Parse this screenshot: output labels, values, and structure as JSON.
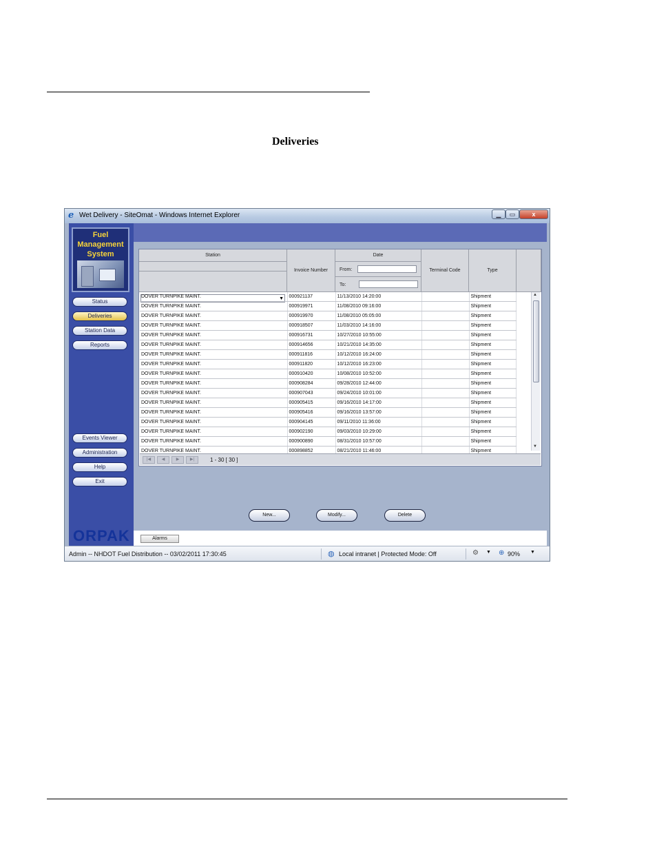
{
  "document": {
    "heading": "Deliveries"
  },
  "window": {
    "title": "Wet Delivery - SiteOmat - Windows Internet Explorer",
    "min_label": "▁",
    "max_label": "▭",
    "close_label": "x"
  },
  "sidebar": {
    "logo_lines": [
      "Fuel",
      "Management",
      "System"
    ],
    "nav_top": [
      {
        "label": "Status",
        "active": false
      },
      {
        "label": "Deliveries",
        "active": true
      },
      {
        "label": "Station Data",
        "active": false
      },
      {
        "label": "Reports",
        "active": false
      }
    ],
    "nav_bottom": [
      {
        "label": "Events Viewer"
      },
      {
        "label": "Administration"
      },
      {
        "label": "Help"
      },
      {
        "label": "Exit"
      }
    ],
    "brand": "ORPAK"
  },
  "grid": {
    "headers": {
      "station": "Station",
      "invoice": "Invoice Number",
      "date": "Date",
      "from": "From:",
      "to": "To:",
      "terminal": "Terminal Code",
      "type": "Type"
    },
    "rows": [
      {
        "station": "DOVER TURNPIKE MAINT.",
        "invoice": "000921137",
        "date": "11/13/2010 14:20:00",
        "terminal": "",
        "type": "Shipment"
      },
      {
        "station": "DOVER TURNPIKE MAINT.",
        "invoice": "000919971",
        "date": "11/08/2010 09:16:00",
        "terminal": "",
        "type": "Shipment"
      },
      {
        "station": "DOVER TURNPIKE MAINT.",
        "invoice": "000919970",
        "date": "11/08/2010 05:05:00",
        "terminal": "",
        "type": "Shipment"
      },
      {
        "station": "DOVER TURNPIKE MAINT.",
        "invoice": "000918507",
        "date": "11/03/2010 14:16:00",
        "terminal": "",
        "type": "Shipment"
      },
      {
        "station": "DOVER TURNPIKE MAINT.",
        "invoice": "000916731",
        "date": "10/27/2010 10:55:00",
        "terminal": "",
        "type": "Shipment"
      },
      {
        "station": "DOVER TURNPIKE MAINT.",
        "invoice": "000914656",
        "date": "10/21/2010 14:35:00",
        "terminal": "",
        "type": "Shipment"
      },
      {
        "station": "DOVER TURNPIKE MAINT.",
        "invoice": "000911816",
        "date": "10/12/2010 16:24:00",
        "terminal": "",
        "type": "Shipment"
      },
      {
        "station": "DOVER TURNPIKE MAINT.",
        "invoice": "000911820",
        "date": "10/12/2010 16:23:00",
        "terminal": "",
        "type": "Shipment"
      },
      {
        "station": "DOVER TURNPIKE MAINT.",
        "invoice": "000910420",
        "date": "10/08/2010 10:52:00",
        "terminal": "",
        "type": "Shipment"
      },
      {
        "station": "DOVER TURNPIKE MAINT.",
        "invoice": "000908284",
        "date": "09/28/2010 12:44:00",
        "terminal": "",
        "type": "Shipment"
      },
      {
        "station": "DOVER TURNPIKE MAINT.",
        "invoice": "000907043",
        "date": "09/24/2010 10:01:00",
        "terminal": "",
        "type": "Shipment"
      },
      {
        "station": "DOVER TURNPIKE MAINT.",
        "invoice": "000905415",
        "date": "09/16/2010 14:17:00",
        "terminal": "",
        "type": "Shipment"
      },
      {
        "station": "DOVER TURNPIKE MAINT.",
        "invoice": "000905416",
        "date": "09/16/2010 13:57:00",
        "terminal": "",
        "type": "Shipment"
      },
      {
        "station": "DOVER TURNPIKE MAINT.",
        "invoice": "000904145",
        "date": "09/11/2010 11:36:00",
        "terminal": "",
        "type": "Shipment"
      },
      {
        "station": "DOVER TURNPIKE MAINT.",
        "invoice": "000902190",
        "date": "09/03/2010 10:29:00",
        "terminal": "",
        "type": "Shipment"
      },
      {
        "station": "DOVER TURNPIKE MAINT.",
        "invoice": "000900890",
        "date": "08/31/2010 10:57:00",
        "terminal": "",
        "type": "Shipment"
      },
      {
        "station": "DOVER TURNPIKE MAINT.",
        "invoice": "000898852",
        "date": "08/21/2010 11:46:00",
        "terminal": "",
        "type": "Shipment"
      }
    ],
    "pager": {
      "first": "|◀",
      "prev": "◀",
      "next": "▶",
      "last": "▶|",
      "count": "1 - 30  [ 30 ]"
    }
  },
  "actions": {
    "new": "New...",
    "modify": "Modify...",
    "delete": "Delete"
  },
  "footer": {
    "alarms": "Alarms"
  },
  "statusbar": {
    "left": "Admin -- NHDOT Fuel Distribution -- 03/02/2011  17:30:45",
    "zone": "Local intranet | Protected Mode: Off",
    "zoom": "90%"
  },
  "colors": {
    "sidebar_bg": "#3a4ea6",
    "header_bar": "#5b6ab6",
    "workspace_bg": "#a6b4cc",
    "active_nav": "#e4c24a",
    "logo_text": "#f6d33a"
  }
}
